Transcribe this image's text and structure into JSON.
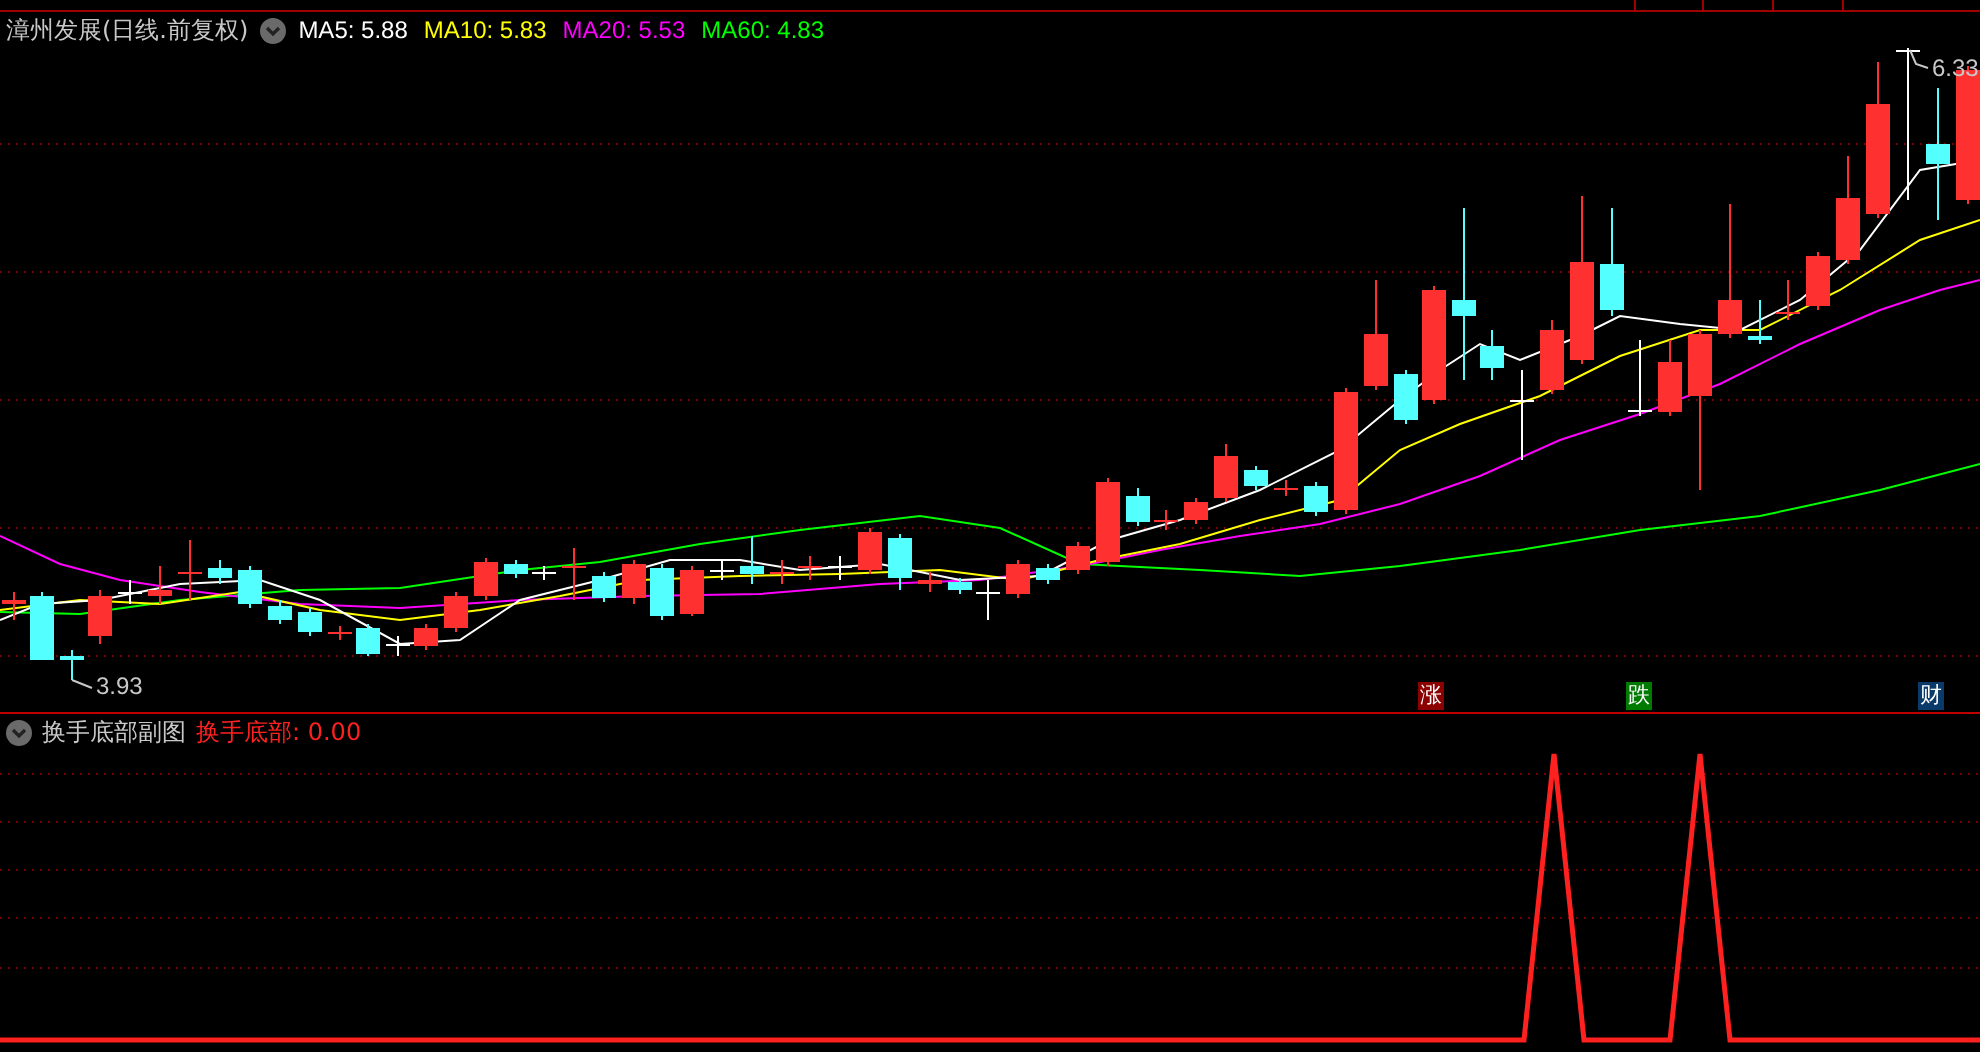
{
  "main_panel": {
    "title": "漳州发展(日线.前复权)",
    "indicators": [
      {
        "label": "MA5: 5.88",
        "color": "#ffffff"
      },
      {
        "label": "MA10: 5.83",
        "color": "#ffff00"
      },
      {
        "label": "MA20: 5.53",
        "color": "#ff00ff"
      },
      {
        "label": "MA60: 4.83",
        "color": "#00ff00"
      }
    ],
    "high_label": "6.33",
    "low_label": "3.93",
    "event_markers": [
      {
        "label": "涨",
        "color": "#8b0000"
      },
      {
        "label": "跌",
        "color": "#007a00"
      },
      {
        "label": "财",
        "color": "#0a3a6a"
      }
    ]
  },
  "sub_panel": {
    "title": "换手底部副图",
    "reading": "换手底部: 0.00"
  }
}
